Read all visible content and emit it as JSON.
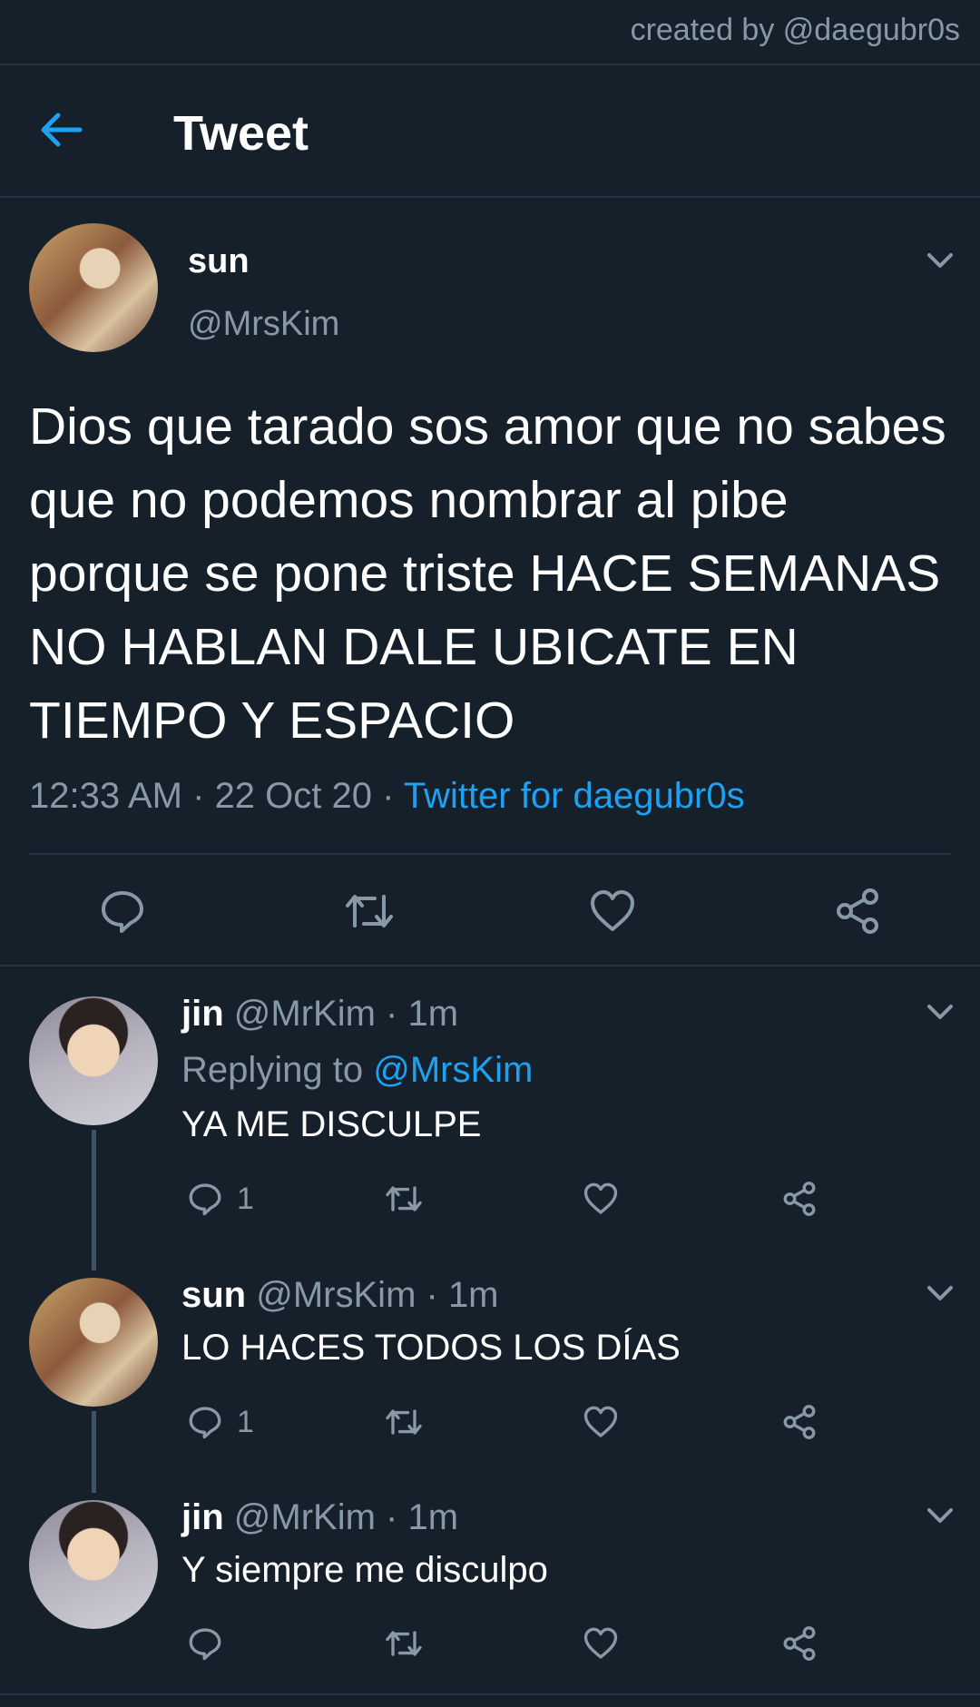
{
  "credit": "created by @daegubr0s",
  "header": {
    "title": "Tweet",
    "back_icon": "arrow-left-icon"
  },
  "colors": {
    "background": "#15202b",
    "accent": "#1da1f2",
    "muted": "#8899a6",
    "divider": "#253341"
  },
  "tweet": {
    "name": "sun",
    "handle": "@MrsKim",
    "text": "Dios que tarado sos amor que no sabes que no podemos nombrar al pibe porque se pone triste HACE SEMANAS NO HABLAN DALE UBICATE EN TIEMPO Y ESPACIO",
    "time": "12:33 AM",
    "date": "22 Oct 20",
    "source": "Twitter for daegubr0s"
  },
  "replies": [
    {
      "name": "jin",
      "handle": "@MrKim",
      "time": "1m",
      "replying_prefix": "Replying to ",
      "replying_to": "@MrsKim",
      "text": "YA ME DISCULPE",
      "reply_count": "1"
    },
    {
      "name": "sun",
      "handle": "@MrsKim",
      "time": "1m",
      "text": "LO HACES TODOS LOS DÍAS",
      "reply_count": "1"
    },
    {
      "name": "jin",
      "handle": "@MrKim",
      "time": "1m",
      "text": "Y siempre me disculpo",
      "reply_count": ""
    }
  ],
  "separator": " · "
}
